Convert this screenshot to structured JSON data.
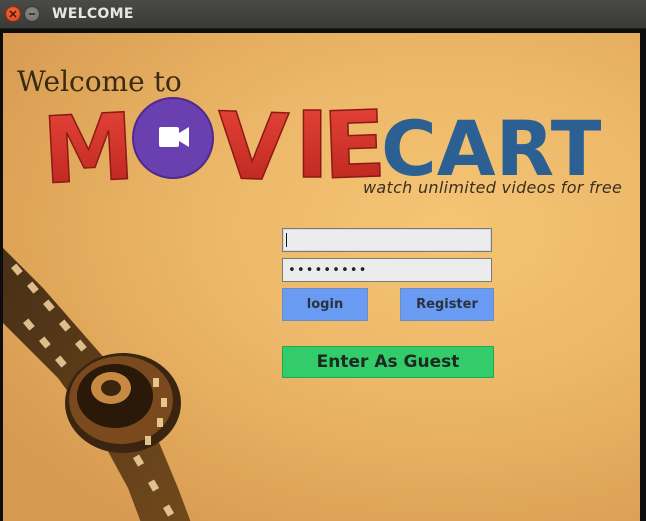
{
  "window": {
    "title": "WELCOME",
    "controls": [
      "close-icon",
      "minimize-icon"
    ]
  },
  "branding": {
    "welcome_text": "Welcome to",
    "logo_part1": "MOVIE",
    "logo_part2": "CART",
    "tagline": "watch unlimited videos for free",
    "colors": {
      "logo_red": "#d8322a",
      "logo_circle": "#6a3fb0",
      "logo_blue": "#2c5f92",
      "panel_bg": "#ecb768"
    }
  },
  "login_form": {
    "username_value": "",
    "password_value": "•••••••••",
    "login_label": "login",
    "register_label": "Register",
    "guest_label": "Enter As Guest",
    "colors": {
      "primary_button": "#6a9bf2",
      "guest_button": "#33cc6a"
    }
  },
  "decor": {
    "film_reel_icon": "film-reel-icon"
  }
}
